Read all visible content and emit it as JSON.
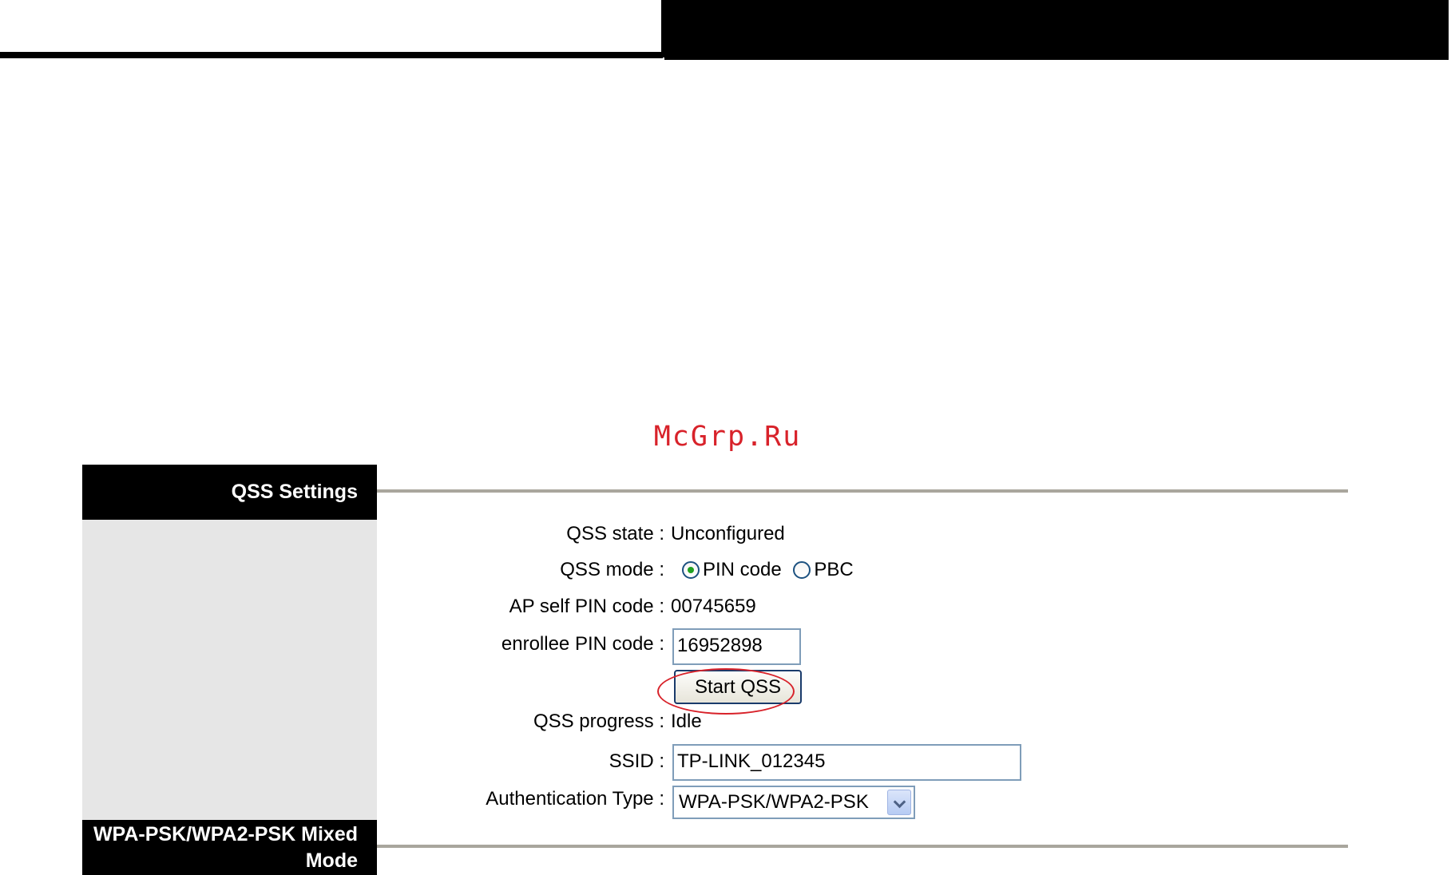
{
  "watermark": "McGrp.Ru",
  "sections": {
    "qss_header": "QSS Settings",
    "wpa_header": "WPA-PSK/WPA2-PSK Mixed Mode"
  },
  "form": {
    "qss_state": {
      "label": "QSS state :",
      "value": "Unconfigured"
    },
    "qss_mode": {
      "label": "QSS mode :",
      "options": [
        {
          "label": "PIN code",
          "selected": true
        },
        {
          "label": "PBC",
          "selected": false
        }
      ]
    },
    "ap_self_pin": {
      "label": "AP self PIN code :",
      "value": "00745659"
    },
    "enrollee_pin": {
      "label": "enrollee PIN code :",
      "value": "16952898"
    },
    "start_button": {
      "label": "Start QSS"
    },
    "qss_progress": {
      "label": "QSS progress :",
      "value": "Idle"
    },
    "ssid": {
      "label": "SSID :",
      "value": "TP-LINK_012345"
    },
    "auth_type": {
      "label": "Authentication Type :",
      "value": "WPA-PSK/WPA2-PSK"
    }
  },
  "colors": {
    "header_bg": "#000000",
    "panel_bg": "#e6e6e6",
    "divider": "#a9a69d",
    "annotation": "#d8222a",
    "radio_dot": "#21a121"
  }
}
